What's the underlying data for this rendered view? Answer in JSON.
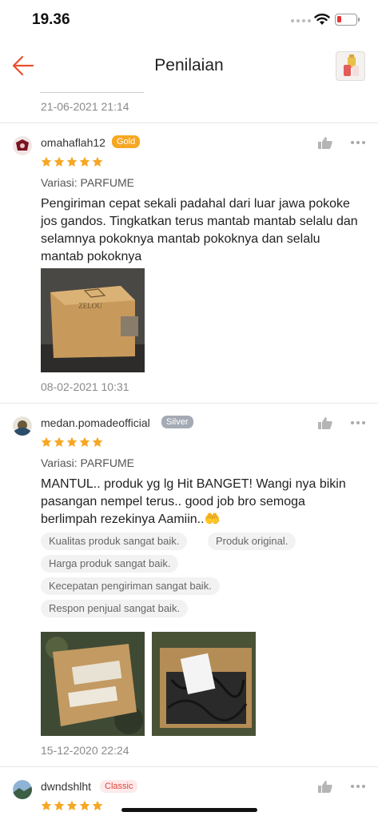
{
  "status": {
    "time": "19.36"
  },
  "nav": {
    "title": "Penilaian"
  },
  "previous": {
    "date": "21-06-2021 21:14"
  },
  "reviews": [
    {
      "username": "omahaflah12",
      "badge": "Gold",
      "rating": 5,
      "variant": "Variasi: PARFUME",
      "text": "Pengiriman cepat sekali padahal dari luar jawa pokoke jos gandos. Tingkatkan terus mantab mantab selalu dan selamnya pokoknya mantab pokoknya dan selalu mantab pokoknya",
      "photo_label": "ZELOU",
      "date": "08-02-2021 10:31"
    },
    {
      "username": "medan.pomadeofficial",
      "badge": "Silver",
      "rating": 5,
      "variant": "Variasi: PARFUME",
      "text": "MANTUL.. produk yg lg Hit BANGET! Wangi nya bikin pasangan nempel terus.. good job bro semoga berlimpah rezekinya Aamiin..🤲",
      "tags": [
        "Kualitas produk sangat baik.",
        "Produk original.",
        "Harga produk sangat baik.",
        "Kecepatan pengiriman sangat baik.",
        "Respon penjual sangat baik."
      ],
      "date": "15-12-2020 22:24"
    },
    {
      "username": "dwndshlht",
      "badge": "Classic",
      "rating": 5
    }
  ],
  "colors": {
    "accent": "#ee4d2d",
    "star": "#f6a723"
  }
}
